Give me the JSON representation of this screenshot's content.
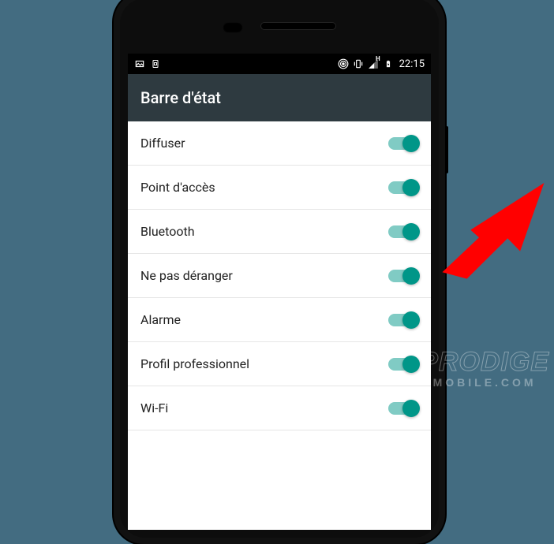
{
  "status": {
    "time": "22:15",
    "sig_label": "H"
  },
  "header": {
    "title": "Barre d'état"
  },
  "rows": [
    {
      "label": "Diffuser"
    },
    {
      "label": "Point d'accès"
    },
    {
      "label": "Bluetooth"
    },
    {
      "label": "Ne pas déranger"
    },
    {
      "label": "Alarme"
    },
    {
      "label": "Profil professionnel"
    },
    {
      "label": "Wi-Fi"
    }
  ],
  "watermark": {
    "line1": "PRODIGE",
    "line2": "MOBILE.COM"
  }
}
